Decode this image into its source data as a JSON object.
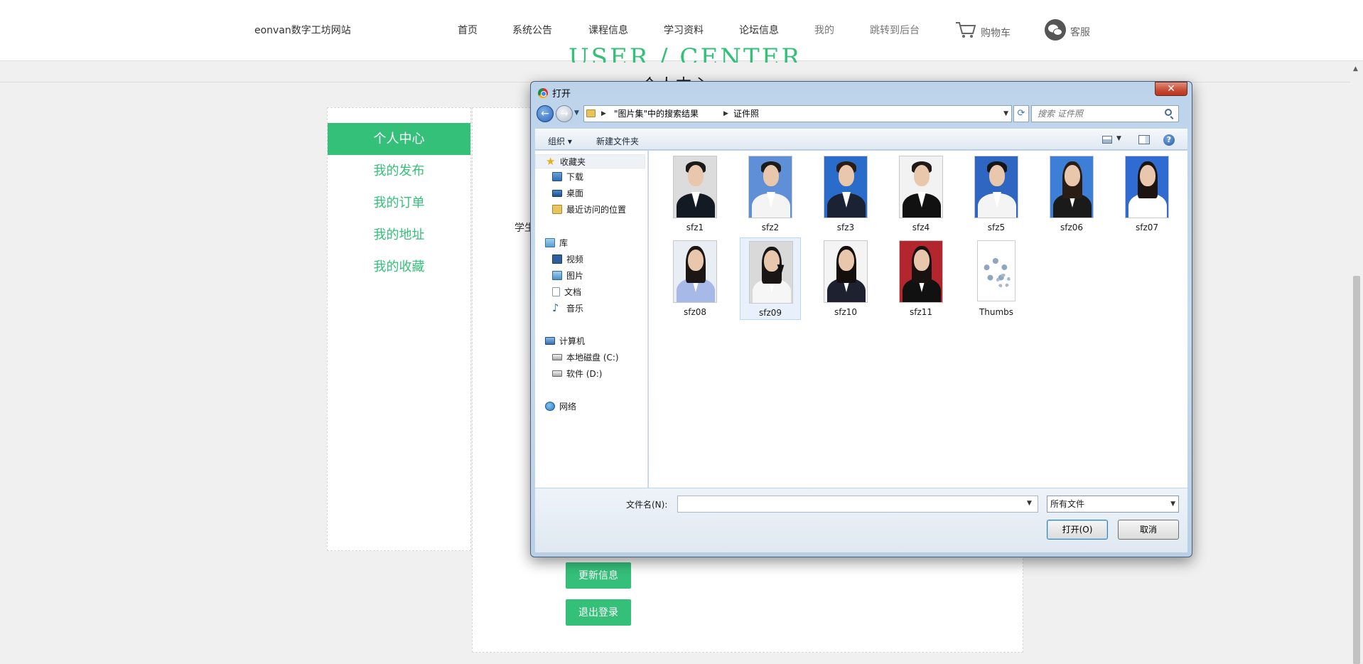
{
  "topnav": {
    "brand": "eonvan数字工坊网站",
    "items": [
      {
        "label": "首页"
      },
      {
        "label": "系统公告"
      },
      {
        "label": "课程信息"
      },
      {
        "label": "学习资料"
      },
      {
        "label": "论坛信息"
      },
      {
        "label": "我的"
      },
      {
        "label": "跳转到后台"
      }
    ],
    "cart_label": "购物车",
    "service_label": "客服"
  },
  "page": {
    "hero_title": "USER / CENTER",
    "hero_subtitle": "个人中心",
    "student_label": "学生",
    "sidebar": [
      {
        "label": "个人中心",
        "active": true
      },
      {
        "label": "我的发布",
        "active": false
      },
      {
        "label": "我的订单",
        "active": false
      },
      {
        "label": "我的地址",
        "active": false
      },
      {
        "label": "我的收藏",
        "active": false
      }
    ],
    "update_button": "更新信息",
    "logout_button": "退出登录",
    "accent_color": "#35c07a"
  },
  "dialog": {
    "title": "打开",
    "close_label": "✕",
    "breadcrumbs": [
      "\"图片集\"中的搜索结果",
      "证件照"
    ],
    "search_placeholder": "搜索 证件照",
    "toolbar": {
      "organize": "组织 ▾",
      "new_folder": "新建文件夹"
    },
    "nav_tree": {
      "favorites": "收藏夹",
      "favorites_items": [
        "下载",
        "桌面",
        "最近访问的位置"
      ],
      "libraries": "库",
      "library_items": [
        "视频",
        "图片",
        "文档",
        "音乐"
      ],
      "computer": "计算机",
      "computer_items": [
        "本地磁盘 (C:)",
        "软件 (D:)"
      ],
      "network": "网络"
    },
    "files": [
      {
        "name": "sfz1",
        "kind": "photo",
        "bg": "#dcdcdc",
        "hair": "#1a1a1a",
        "cloth": "#141a24",
        "long": false
      },
      {
        "name": "sfz2",
        "kind": "photo",
        "bg": "#5f8fd6",
        "hair": "#1c1c1c",
        "cloth": "#f4f4f4",
        "long": false
      },
      {
        "name": "sfz3",
        "kind": "photo",
        "bg": "#2a6cc9",
        "hair": "#2a1d14",
        "cloth": "#1b2233",
        "long": false
      },
      {
        "name": "sfz4",
        "kind": "photo",
        "bg": "#f2f2f2",
        "hair": "#1f1a18",
        "cloth": "#111111",
        "long": false
      },
      {
        "name": "sfz5",
        "kind": "photo",
        "bg": "#2f66c2",
        "hair": "#151515",
        "cloth": "#f4f4f4",
        "long": false
      },
      {
        "name": "sfz06",
        "kind": "photo",
        "bg": "#3d7fd6",
        "hair": "#2a1d15",
        "cloth": "#1a1a1a",
        "long": true
      },
      {
        "name": "sfz07",
        "kind": "photo",
        "bg": "#2f6bd0",
        "hair": "#1c1410",
        "cloth": "#ffffff",
        "long": true
      },
      {
        "name": "sfz08",
        "kind": "photo",
        "bg": "#e9eef5",
        "hair": "#1c1614",
        "cloth": "#a7b9e6",
        "long": true
      },
      {
        "name": "sfz09",
        "kind": "photo",
        "bg": "#d9d9d9",
        "hair": "#1a1616",
        "cloth": "#f6f6f6",
        "long": true
      },
      {
        "name": "sfz10",
        "kind": "photo",
        "bg": "#f4f4f4",
        "hair": "#140f0c",
        "cloth": "#1e2230",
        "long": true
      },
      {
        "name": "sfz11",
        "kind": "photo",
        "bg": "#b3262e",
        "hair": "#1a1210",
        "cloth": "#111111",
        "long": true
      },
      {
        "name": "Thumbs",
        "kind": "system"
      }
    ],
    "selected_file": "sfz09",
    "filename_label": "文件名(N):",
    "filename_value": "",
    "filter_value": "所有文件",
    "open_button": "打开(O)",
    "cancel_button": "取消"
  }
}
